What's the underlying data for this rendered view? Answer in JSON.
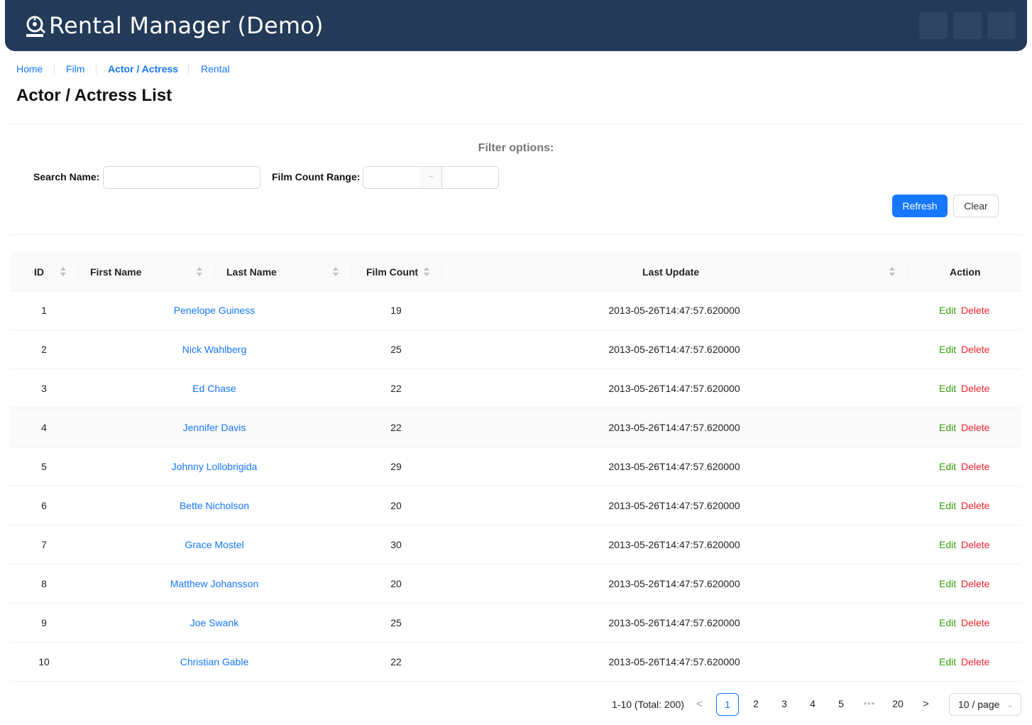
{
  "app": {
    "title": "Rental Manager (Demo)"
  },
  "breadcrumb": [
    {
      "label": "Home",
      "active": false
    },
    {
      "label": "Film",
      "active": false
    },
    {
      "label": "Actor / Actress",
      "active": true
    },
    {
      "label": "Rental",
      "active": false
    }
  ],
  "page": {
    "title": "Actor / Actress List"
  },
  "filters": {
    "title": "Filter options:",
    "search_name_label": "Search Name:",
    "search_name_value": "",
    "film_count_label": "Film Count Range:",
    "range_separator": "~",
    "range_min": "",
    "range_max": "",
    "refresh_label": "Refresh",
    "clear_label": "Clear"
  },
  "table": {
    "headers": {
      "id": "ID",
      "first_name": "First Name",
      "last_name": "Last Name",
      "film_count": "Film Count",
      "last_update": "Last Update",
      "action": "Action"
    },
    "rows": [
      {
        "id": "1",
        "name": "Penelope Guiness",
        "film_count": "19",
        "last_update": "2013-05-26T14:47:57.620000",
        "edit": "Edit",
        "delete": "Delete"
      },
      {
        "id": "2",
        "name": "Nick Wahlberg",
        "film_count": "25",
        "last_update": "2013-05-26T14:47:57.620000",
        "edit": "Edit",
        "delete": "Delete"
      },
      {
        "id": "3",
        "name": "Ed Chase",
        "film_count": "22",
        "last_update": "2013-05-26T14:47:57.620000",
        "edit": "Edit",
        "delete": "Delete"
      },
      {
        "id": "4",
        "name": "Jennifer Davis",
        "film_count": "22",
        "last_update": "2013-05-26T14:47:57.620000",
        "edit": "Edit",
        "delete": "Delete"
      },
      {
        "id": "5",
        "name": "Johnny Lollobrigida",
        "film_count": "29",
        "last_update": "2013-05-26T14:47:57.620000",
        "edit": "Edit",
        "delete": "Delete"
      },
      {
        "id": "6",
        "name": "Bette Nicholson",
        "film_count": "20",
        "last_update": "2013-05-26T14:47:57.620000",
        "edit": "Edit",
        "delete": "Delete"
      },
      {
        "id": "7",
        "name": "Grace Mostel",
        "film_count": "30",
        "last_update": "2013-05-26T14:47:57.620000",
        "edit": "Edit",
        "delete": "Delete"
      },
      {
        "id": "8",
        "name": "Matthew Johansson",
        "film_count": "20",
        "last_update": "2013-05-26T14:47:57.620000",
        "edit": "Edit",
        "delete": "Delete"
      },
      {
        "id": "9",
        "name": "Joe Swank",
        "film_count": "25",
        "last_update": "2013-05-26T14:47:57.620000",
        "edit": "Edit",
        "delete": "Delete"
      },
      {
        "id": "10",
        "name": "Christian Gable",
        "film_count": "22",
        "last_update": "2013-05-26T14:47:57.620000",
        "edit": "Edit",
        "delete": "Delete"
      }
    ],
    "hovered_row_index": 3
  },
  "pagination": {
    "total_text": "1-10 (Total: 200)",
    "prev": "<",
    "next": ">",
    "pages": [
      "1",
      "2",
      "3",
      "4",
      "5"
    ],
    "ellipsis": "•••",
    "last_page": "20",
    "current_page": "1",
    "page_size": "10 / page"
  },
  "icons": {
    "logo": "film-reel-icon",
    "sort": "sort-icon",
    "dropdown": "chevron-down-icon"
  },
  "colors": {
    "header_bg": "#233a58",
    "primary": "#1677ff",
    "edit": "#389e0d",
    "delete": "#f5222d"
  }
}
